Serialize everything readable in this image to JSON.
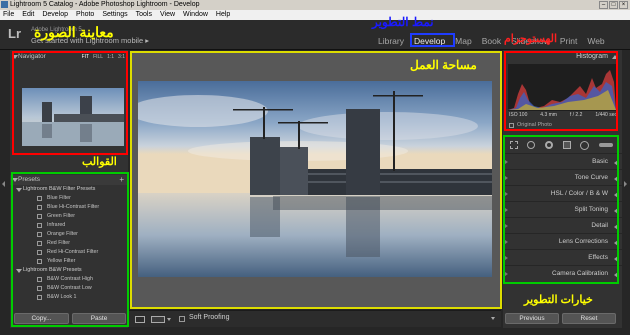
{
  "window": {
    "title": "Lightroom 5 Catalog - Adobe Photoshop Lightroom - Develop",
    "controls": [
      "–",
      "□",
      "×"
    ]
  },
  "menu": [
    "File",
    "Edit",
    "Develop",
    "Photo",
    "Settings",
    "Tools",
    "View",
    "Window",
    "Help"
  ],
  "identity": {
    "logo": "Lr",
    "small_text": "Adobe Lightroom 5",
    "main_text": "Get started with Lightroom mobile ▸"
  },
  "modules": {
    "items": [
      "Library",
      "Develop",
      "Map",
      "Book",
      "Slideshow",
      "Print",
      "Web"
    ],
    "active_index": 1
  },
  "annotations": {
    "preview_panel": "معاينة الصورة",
    "develop_mode": "نمط التطوير",
    "histogram": "الهستوجرام",
    "workspace": "مساحة العمل",
    "presets": "القوالب",
    "develop_options": "خيارات التطوير"
  },
  "colors": {
    "annotation_text": "#ffff00",
    "annotation_blue": "#1a1aff",
    "box_red": "#ff0000",
    "box_green": "#00cc00",
    "box_yellow": "#dddd00",
    "box_blue": "#1f3cff",
    "panel_bg": "#323232",
    "work_bg": "#585858"
  },
  "navigator": {
    "label": "Navigator",
    "zoom_options": [
      "FIT",
      "FILL",
      "1:1",
      "3:1"
    ]
  },
  "presets": {
    "label": "Presets",
    "add_icon": "+",
    "folders": [
      {
        "name": "Lightroom B&W Filter Presets",
        "items": [
          "Blue Filter",
          "Blue Hi-Contrast Filter",
          "Green Filter",
          "Infrared",
          "Orange Filter",
          "Red Filter",
          "Red Hi-Contrast Filter",
          "Yellow Filter"
        ]
      },
      {
        "name": "Lightroom B&W Presets",
        "items": [
          "B&W Contrast High",
          "B&W Contrast Low",
          "B&W Look 1"
        ]
      }
    ]
  },
  "left_buttons": {
    "copy": "Copy...",
    "paste": "Paste"
  },
  "histogram": {
    "label": "Histogram",
    "info": [
      "ISO 100",
      "4.3 mm",
      "f / 2.2",
      "1/440 sec"
    ],
    "original_photo": "Original Photo"
  },
  "develop_sections": [
    {
      "label": "Basic"
    },
    {
      "label": "Tone Curve"
    },
    {
      "label": "HSL / Color / B & W"
    },
    {
      "label": "Split Toning"
    },
    {
      "label": "Detail"
    },
    {
      "label": "Lens Corrections"
    },
    {
      "label": "Effects"
    },
    {
      "label": "Camera Calibration"
    }
  ],
  "right_buttons": {
    "previous": "Previous",
    "reset": "Reset"
  },
  "toolbar": {
    "soft_proofing": "Soft Proofing",
    "view_icons": [
      "loupe-view-icon",
      "before-after-icon"
    ]
  }
}
